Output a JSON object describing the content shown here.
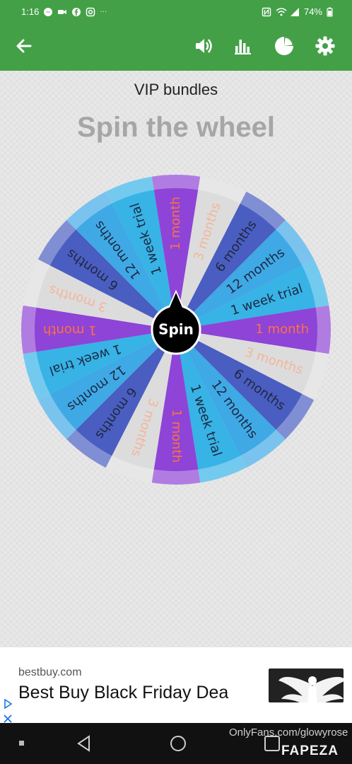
{
  "status_bar": {
    "time": "1:16",
    "dots": "···",
    "battery": "74%"
  },
  "toolbar": {
    "back_icon": "arrow-back-icon",
    "sound_icon": "volume-icon",
    "stats_icon": "bar-chart-icon",
    "pie_icon": "pie-chart-icon",
    "settings_icon": "gear-icon"
  },
  "main": {
    "subtitle": "VIP bundles",
    "title": "Spin the wheel",
    "spin_label": "Spin"
  },
  "wheel": {
    "segments": [
      {
        "label": "1 month",
        "fill": "#8e44d6",
        "text_color": "#ff7043"
      },
      {
        "label": "3 months",
        "fill": "#dcdcdc",
        "text_color": "#f4b59a"
      },
      {
        "label": "6 months",
        "fill": "#4a5dc0",
        "text_color": "#1e2840"
      },
      {
        "label": "12 months",
        "fill": "#3fa9e6",
        "text_color": "#1e2840"
      },
      {
        "label": "1 week trial",
        "fill": "#37b3e6",
        "text_color": "#1e2840"
      },
      {
        "label": "1 month",
        "fill": "#8e44d6",
        "text_color": "#ff7043"
      },
      {
        "label": "3 months",
        "fill": "#dcdcdc",
        "text_color": "#f4b59a"
      },
      {
        "label": "6 months",
        "fill": "#4a5dc0",
        "text_color": "#1e2840"
      },
      {
        "label": "12 months",
        "fill": "#3fa9e6",
        "text_color": "#1e2840"
      },
      {
        "label": "1 week trial",
        "fill": "#37b3e6",
        "text_color": "#1e2840"
      },
      {
        "label": "1 month",
        "fill": "#8e44d6",
        "text_color": "#ff7043"
      },
      {
        "label": "3 months",
        "fill": "#dcdcdc",
        "text_color": "#f4b59a"
      },
      {
        "label": "6 months",
        "fill": "#4a5dc0",
        "text_color": "#1e2840"
      },
      {
        "label": "12 months",
        "fill": "#3fa9e6",
        "text_color": "#1e2840"
      },
      {
        "label": "1 week trial",
        "fill": "#37b3e6",
        "text_color": "#1e2840"
      },
      {
        "label": "1 month",
        "fill": "#8e44d6",
        "text_color": "#ff7043"
      },
      {
        "label": "3 months",
        "fill": "#dcdcdc",
        "text_color": "#f4b59a"
      },
      {
        "label": "6 months",
        "fill": "#4a5dc0",
        "text_color": "#1e2840"
      },
      {
        "label": "12 months",
        "fill": "#3fa9e6",
        "text_color": "#1e2840"
      },
      {
        "label": "1 week trial",
        "fill": "#37b3e6",
        "text_color": "#1e2840"
      }
    ]
  },
  "ad": {
    "domain": "bestbuy.com",
    "headline": "Best Buy Black Friday Dea",
    "ad_choices_icon": "ad-choices-icon",
    "close_icon": "close-icon"
  },
  "nav": {
    "back_icon": "nav-back-icon",
    "home_icon": "nav-home-icon",
    "recents_icon": "nav-recents-icon"
  },
  "watermark": {
    "text": "OnlyFans.com/glowyrose",
    "brand": "FAPEZA"
  },
  "colors": {
    "app_green": "#43a047",
    "background": "#e8e8e8"
  }
}
